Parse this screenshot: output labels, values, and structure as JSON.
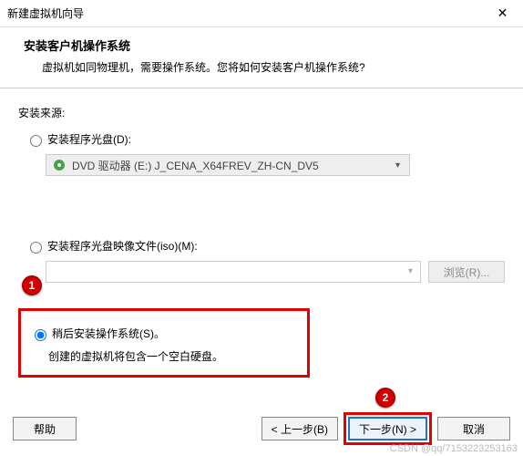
{
  "window": {
    "title": "新建虚拟机向导",
    "close_symbol": "✕"
  },
  "header": {
    "title": "安装客户机操作系统",
    "subtitle": "虚拟机如同物理机，需要操作系统。您将如何安装客户机操作系统?"
  },
  "section_label": "安装来源:",
  "options": {
    "disc": {
      "label": "安装程序光盘(D):",
      "drive_text": "DVD 驱动器 (E:) J_CENA_X64FREV_ZH-CN_DV5"
    },
    "iso": {
      "label": "安装程序光盘映像文件(iso)(M):",
      "browse_label": "浏览(R)..."
    },
    "later": {
      "label": "稍后安装操作系统(S)。",
      "desc": "创建的虚拟机将包含一个空白硬盘。"
    }
  },
  "callouts": {
    "one": "1",
    "two": "2"
  },
  "footer": {
    "help": "帮助",
    "back": "< 上一步(B)",
    "next": "下一步(N) >",
    "cancel": "取消"
  },
  "watermark": "CSDN @qq/7153223253163"
}
